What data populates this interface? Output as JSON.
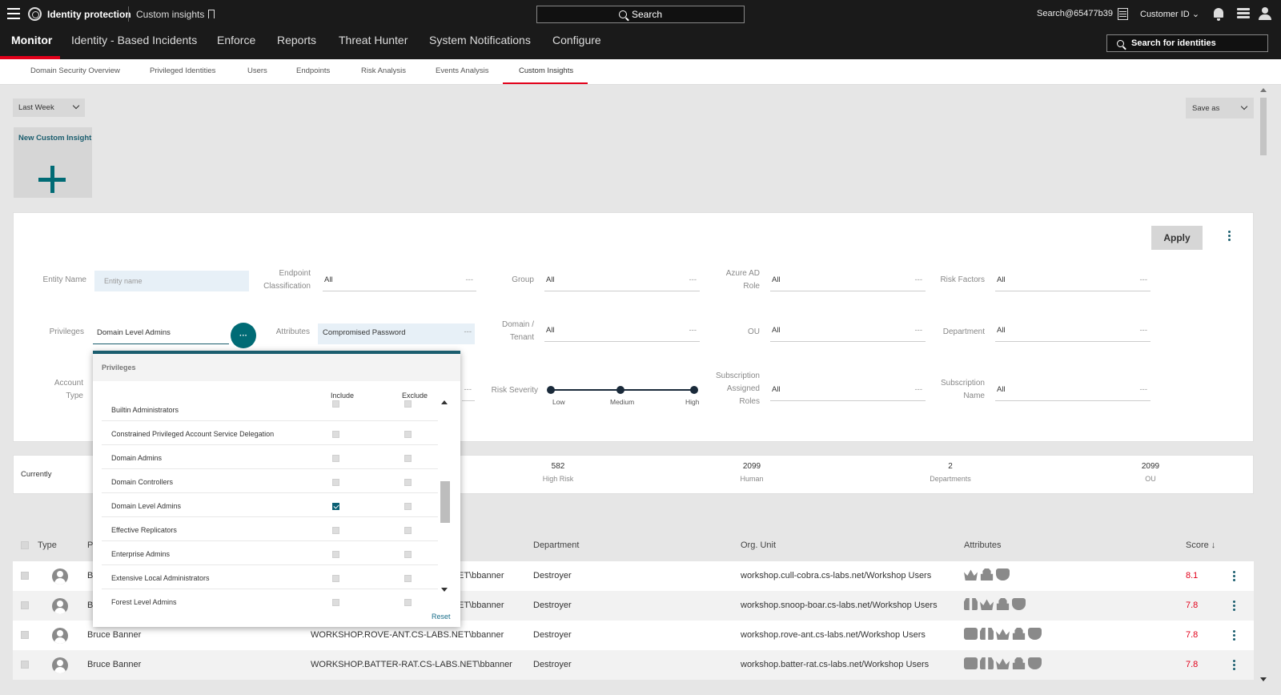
{
  "app": {
    "title": "Identity protection",
    "breadcrumb": "Custom insights",
    "search_label": "Search",
    "account": "Search@65477b39",
    "customer": "Customer ID",
    "identity_search_placeholder": "Search for identities"
  },
  "nav": {
    "items": [
      "Monitor",
      "Identity - Based Incidents",
      "Enforce",
      "Reports",
      "Threat Hunter",
      "System Notifications",
      "Configure"
    ],
    "active": "Monitor"
  },
  "subtabs": {
    "items": [
      "Domain Security Overview",
      "Privileged Identities",
      "Users",
      "Endpoints",
      "Risk Analysis",
      "Events Analysis",
      "Custom Insights"
    ],
    "active": "Custom Insights"
  },
  "toolbar": {
    "period": "Last Week",
    "save_as": "Save as",
    "new_custom_insight": "New Custom Insight",
    "apply": "Apply"
  },
  "filters": {
    "entity_name": {
      "label": "Entity Name",
      "placeholder": "Entity name"
    },
    "endpoint_classification": {
      "label": "Endpoint Classification",
      "value": "All"
    },
    "group": {
      "label": "Group",
      "value": "All"
    },
    "azure_ad_role": {
      "label": "Azure AD Role",
      "value": "All"
    },
    "risk_factors": {
      "label": "Risk Factors",
      "value": "All"
    },
    "privileges": {
      "label": "Privileges",
      "value": "Domain Level Admins",
      "button": "···"
    },
    "attributes": {
      "label": "Attributes",
      "value": "Compromised Password"
    },
    "domain_tenant": {
      "label": "Domain / Tenant",
      "value": "All"
    },
    "ou": {
      "label": "OU",
      "value": "All"
    },
    "department": {
      "label": "Department",
      "value": "All"
    },
    "account_type": {
      "label": "Account Type"
    },
    "risk_severity": {
      "label": "Risk Severity",
      "levels": [
        "Low",
        "Medium",
        "High"
      ]
    },
    "subscription_assigned_roles": {
      "label": "Subscription Assigned Roles",
      "value": "All"
    },
    "subscription_name": {
      "label": "Subscription Name",
      "value": "All"
    },
    "dash": "---"
  },
  "privileges_popup": {
    "title": "Privileges",
    "include": "Include",
    "exclude": "Exclude",
    "reset": "Reset",
    "items": [
      {
        "name": "Builtin Administrators",
        "include": false
      },
      {
        "name": "Constrained Privileged Account Service Delegation",
        "include": false
      },
      {
        "name": "Domain Admins",
        "include": false
      },
      {
        "name": "Domain Controllers",
        "include": false
      },
      {
        "name": "Domain Level Admins",
        "include": true
      },
      {
        "name": "Effective Replicators",
        "include": false
      },
      {
        "name": "Enterprise Admins",
        "include": false
      },
      {
        "name": "Extensive Local Administrators",
        "include": false
      },
      {
        "name": "Forest Level Admins",
        "include": false
      }
    ]
  },
  "stats": {
    "currently": "Currently",
    "items": [
      {
        "value": "582",
        "label": "High Risk"
      },
      {
        "value": "2099",
        "label": "Human"
      },
      {
        "value": "2",
        "label": "Departments"
      },
      {
        "value": "2099",
        "label": "OU"
      }
    ]
  },
  "table": {
    "headers": {
      "type": "Type",
      "p": "P",
      "department": "Department",
      "org_unit": "Org. Unit",
      "attributes": "Attributes",
      "score": "Score ↓"
    },
    "rows": [
      {
        "name": "B",
        "account": "ET\\bbanner",
        "department": "Destroyer",
        "org_unit": "workshop.cull-cobra.cs-labs.net/Workshop Users",
        "score": "8.1",
        "icons": [
          "crown-icon",
          "lock-icon",
          "fragile-icon"
        ]
      },
      {
        "name": "B",
        "account": "ET\\bbanner",
        "department": "Destroyer",
        "org_unit": "workshop.snoop-boar.cs-labs.net/Workshop Users",
        "score": "7.8",
        "icons": [
          "binoculars-icon",
          "crown-icon",
          "lock-icon",
          "fragile-icon"
        ]
      },
      {
        "name": "Bruce Banner",
        "account": "WORKSHOP.ROVE-ANT.CS-LABS.NET\\bbanner",
        "department": "Destroyer",
        "org_unit": "workshop.rove-ant.cs-labs.net/Workshop Users",
        "score": "7.8",
        "icons": [
          "target-icon",
          "binoculars-icon",
          "crown-icon",
          "lock-icon",
          "fragile-icon"
        ]
      },
      {
        "name": "Bruce Banner",
        "account": "WORKSHOP.BATTER-RAT.CS-LABS.NET\\bbanner",
        "department": "Destroyer",
        "org_unit": "workshop.batter-rat.cs-labs.net/Workshop Users",
        "score": "7.8",
        "icons": [
          "target-icon",
          "binoculars-icon",
          "crown-icon",
          "lock-icon",
          "fragile-icon"
        ]
      }
    ]
  }
}
